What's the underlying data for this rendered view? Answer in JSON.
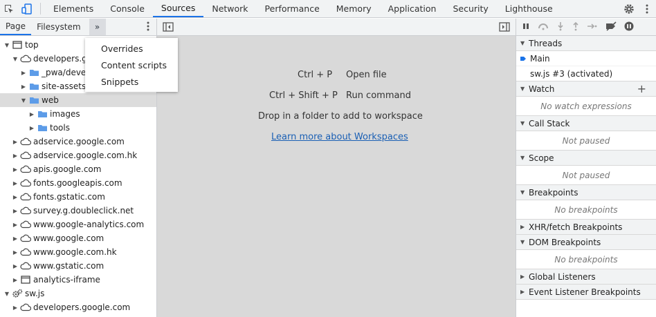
{
  "top_tabs": [
    "Elements",
    "Console",
    "Sources",
    "Network",
    "Performance",
    "Memory",
    "Application",
    "Security",
    "Lighthouse"
  ],
  "left_tabs": [
    "Page",
    "Filesystem"
  ],
  "more_label": "»",
  "menu": [
    "Overrides",
    "Content scripts",
    "Snippets"
  ],
  "tree": [
    {
      "label": "top"
    },
    {
      "label": "developers.goo"
    },
    {
      "label": "_pwa/devel"
    },
    {
      "label": "site-assets"
    },
    {
      "label": "web"
    },
    {
      "label": "images"
    },
    {
      "label": "tools"
    },
    {
      "label": "adservice.google.com"
    },
    {
      "label": "adservice.google.com.hk"
    },
    {
      "label": "apis.google.com"
    },
    {
      "label": "fonts.googleapis.com"
    },
    {
      "label": "fonts.gstatic.com"
    },
    {
      "label": "survey.g.doubleclick.net"
    },
    {
      "label": "www.google-analytics.com"
    },
    {
      "label": "www.google.com"
    },
    {
      "label": "www.google.com.hk"
    },
    {
      "label": "www.gstatic.com"
    },
    {
      "label": "analytics-iframe"
    },
    {
      "label": "sw.js"
    },
    {
      "label": "developers.google.com"
    }
  ],
  "middle": {
    "shortcut1_keys": "Ctrl + P",
    "shortcut1_action": "Open file",
    "shortcut2_keys": "Ctrl + Shift + P",
    "shortcut2_action": "Run command",
    "drop_text": "Drop in a folder to add to workspace",
    "learn_link": "Learn more about Workspaces"
  },
  "right": {
    "threads_title": "Threads",
    "thread_main": "Main",
    "thread_sw": "sw.js #3 (activated)",
    "watch_title": "Watch",
    "watch_empty": "No watch expressions",
    "callstack_title": "Call Stack",
    "callstack_empty": "Not paused",
    "scope_title": "Scope",
    "scope_empty": "Not paused",
    "breakpoints_title": "Breakpoints",
    "breakpoints_empty": "No breakpoints",
    "xhr_title": "XHR/fetch Breakpoints",
    "dom_title": "DOM Breakpoints",
    "dom_empty": "No breakpoints",
    "global_title": "Global Listeners",
    "event_title": "Event Listener Breakpoints"
  },
  "colors": {
    "accent": "#1a73e8",
    "folder": "#5d9ce8",
    "link": "#1a5fb4"
  }
}
